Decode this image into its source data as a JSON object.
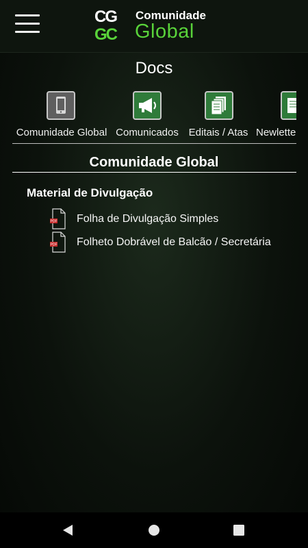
{
  "header": {
    "menu_icon": "hamburger-menu-icon",
    "logo": {
      "mark_row1": "CG",
      "mark_row2": "GC",
      "line1": "Comunidade",
      "line2": "Global"
    }
  },
  "page_title": "Docs",
  "tabs": [
    {
      "label": "Comunidade Global",
      "icon": "smartphone-icon",
      "selected": true
    },
    {
      "label": "Comunicados",
      "icon": "megaphone-icon"
    },
    {
      "label": "Editais / Atas",
      "icon": "documents-icon"
    },
    {
      "label": "Newletters",
      "icon": "newsletter-icon"
    }
  ],
  "section_title": "Comunidade Global",
  "category": "Material de Divulgação",
  "documents": [
    {
      "label": "Folha de Divulgação Simples",
      "icon": "pdf-file-icon"
    },
    {
      "label": "Folheto Dobrável de Balcão / Secretária",
      "icon": "pdf-file-icon"
    }
  ],
  "navbar": {
    "back_icon": "back-triangle-icon",
    "home_icon": "home-circle-icon",
    "recents_icon": "recents-square-icon"
  },
  "colors": {
    "brand_green": "#59d33a",
    "tab_green": "#2f7b3a",
    "header_bg": "#0e150e"
  }
}
